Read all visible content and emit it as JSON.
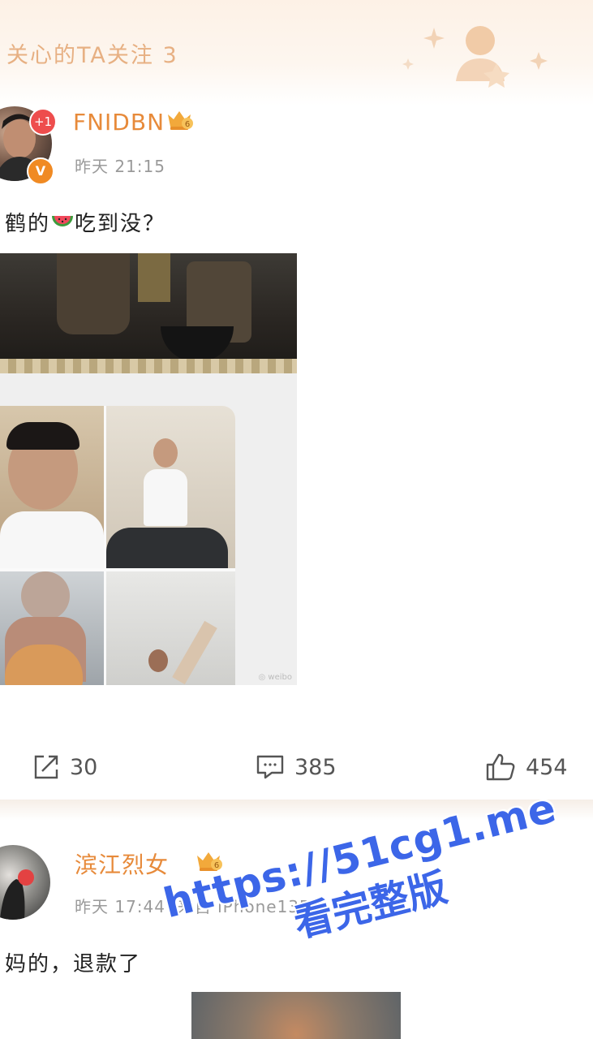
{
  "banner": {
    "text": "关心的TA关注 3"
  },
  "posts": [
    {
      "username": "FNIDBN",
      "badge_count": "+1",
      "verified_mark": "V",
      "time": "昨天 21:15",
      "text_before": "鹤的",
      "text_after": "吃到没？",
      "emoji": "watermelon-icon",
      "images": [
        "temple-scene",
        "video-call-grid"
      ],
      "actions": {
        "repost": "30",
        "comment": "385",
        "like": "454"
      }
    },
    {
      "username": "滨江烈女",
      "time": "昨天 17:44",
      "source": "来自 iPhone13Pro",
      "text": "妈的，退款了"
    }
  ],
  "overlay": {
    "url": "https://51cg1.me",
    "sub": "看完整版"
  },
  "colors": {
    "username": "#e78a3a",
    "banner_text": "#e7b083",
    "meta": "#9a9a9a",
    "overlay": "#3c66e8"
  },
  "icons": [
    "repost-icon",
    "comment-icon",
    "like-icon",
    "vip-crown-icon",
    "watermelon-icon"
  ]
}
